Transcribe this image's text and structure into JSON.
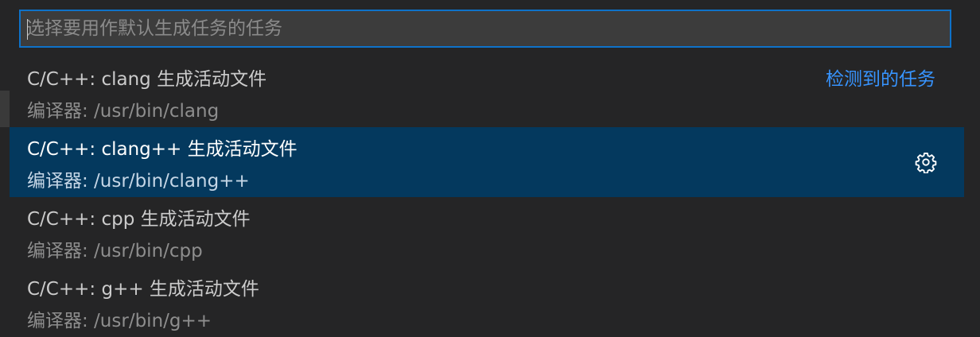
{
  "search": {
    "placeholder": "选择要用作默认生成任务的任务",
    "value": ""
  },
  "items": [
    {
      "label": "C/C++: clang 生成活动文件",
      "detail": "编译器: /usr/bin/clang",
      "separator": "检测到的任务"
    },
    {
      "label": "C/C++: clang++ 生成活动文件",
      "detail": "编译器: /usr/bin/clang++",
      "action_icon": "gear-icon"
    },
    {
      "label": "C/C++: cpp 生成活动文件",
      "detail": "编译器: /usr/bin/cpp"
    },
    {
      "label": "C/C++: g++ 生成活动文件",
      "detail": "编译器: /usr/bin/g++"
    }
  ],
  "colors": {
    "background": "#252526",
    "input_background": "#3c3c3c",
    "focus_border": "#0e72c9",
    "selection_background": "#04395e",
    "link": "#3794ff"
  }
}
